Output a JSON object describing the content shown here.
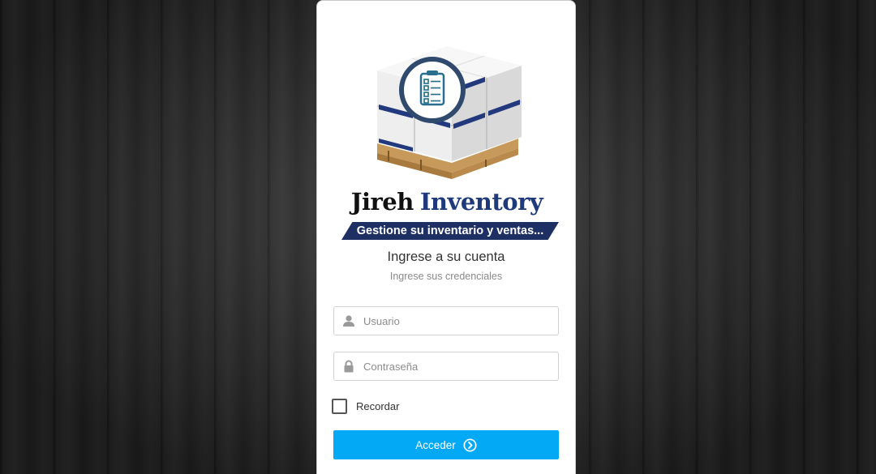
{
  "brand": {
    "name_part1": "Jireh",
    "name_part2": "Inventory",
    "tagline": "Gestione su inventario y ventas...",
    "accent_color": "#1e2f63"
  },
  "login": {
    "title": "Ingrese a su cuenta",
    "subtitle": "Ingrese sus credenciales",
    "username": {
      "placeholder": "Usuario",
      "value": "",
      "icon": "user-icon"
    },
    "password": {
      "placeholder": "Contraseña",
      "value": "",
      "icon": "lock-icon"
    },
    "remember_label": "Recordar",
    "remember_checked": false,
    "submit_label": "Acceder",
    "submit_icon": "chevron-right-circle-icon",
    "button_color": "#03a9f4"
  }
}
